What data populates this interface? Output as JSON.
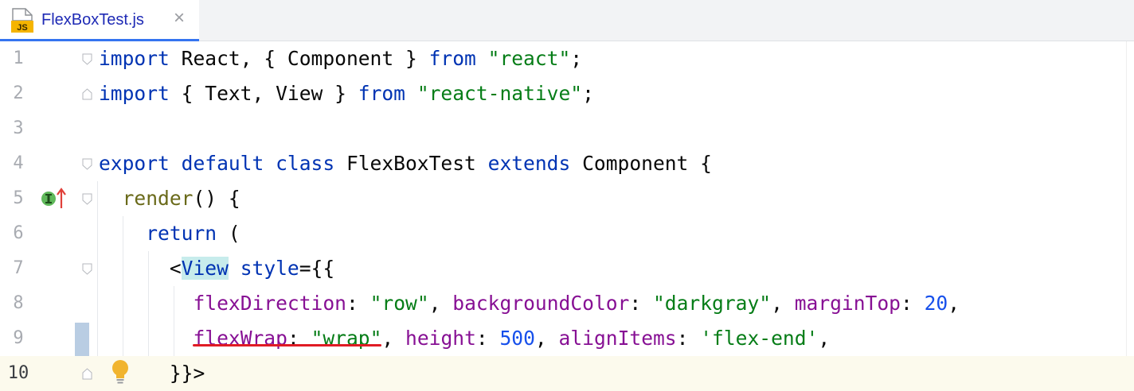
{
  "tab": {
    "file_icon_label": "JS",
    "filename": "FlexBoxTest.js",
    "close_glyph": "×"
  },
  "editor": {
    "line_numbers": [
      "1",
      "2",
      "3",
      "4",
      "5",
      "6",
      "7",
      "8",
      "9",
      "10"
    ],
    "current_line": 10,
    "lines": {
      "l1": {
        "kw1": "import",
        "t1": " React, { Component } ",
        "kw2": "from",
        "sp": " ",
        "str": "\"react\"",
        "end": ";"
      },
      "l2": {
        "kw1": "import",
        "t1": " { Text, View } ",
        "kw2": "from",
        "sp": " ",
        "str": "\"react-native\"",
        "end": ";"
      },
      "l4": {
        "kw1": "export default class",
        "t1": " FlexBoxTest ",
        "kw2": "extends",
        "t2": " Component {"
      },
      "l5": {
        "indent": "  ",
        "fn": "render",
        "t1": "() {"
      },
      "l6": {
        "indent": "    ",
        "kw": "return",
        "t1": " ("
      },
      "l7": {
        "indent": "      ",
        "lt": "<",
        "tag": "View",
        "sp": " ",
        "attr": "style",
        "t1": "={{"
      },
      "l8": {
        "indent": "        ",
        "p1": "flexDirection",
        "c1": ": ",
        "s1": "\"row\"",
        "sep1": ", ",
        "p2": "backgroundColor",
        "c2": ": ",
        "s2": "\"darkgray\"",
        "sep2": ", ",
        "p3": "marginTop",
        "c3": ": ",
        "n3": "20",
        "sep3": ","
      },
      "l9": {
        "indent": "        ",
        "p1": "flexWrap",
        "c1": ": ",
        "s1": "\"wrap\"",
        "sep1": ", ",
        "p2": "height",
        "c2": ": ",
        "n2": "500",
        "sep2": ", ",
        "p3": "alignItems",
        "c3": ": ",
        "s3": "'flex-end'",
        "sep3": ","
      },
      "l10": {
        "indent": "      ",
        "t1": "}}>"
      }
    }
  },
  "colors": {
    "keyword": "#0033b3",
    "string": "#067d17",
    "number": "#1750eb",
    "property": "#871094",
    "function": "#6a6a1a",
    "error_underline": "#e01b24",
    "tab_accent": "#3574f0"
  },
  "icons": {
    "implements_gutter": "implements-method-icon",
    "intention": "lightbulb-icon",
    "fold": "fold-marker-icon"
  }
}
